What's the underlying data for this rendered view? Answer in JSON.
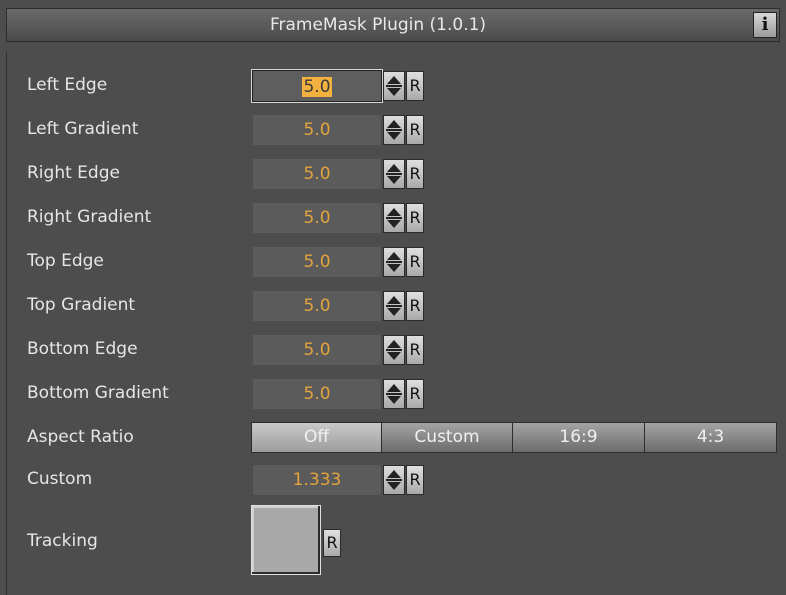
{
  "window": {
    "title": "FrameMask Plugin (1.0.1)",
    "info_label": "i"
  },
  "params": [
    {
      "label": "Left Edge",
      "value": "5.0",
      "active": true
    },
    {
      "label": "Left Gradient",
      "value": "5.0"
    },
    {
      "label": "Right Edge",
      "value": "5.0"
    },
    {
      "label": "Right Gradient",
      "value": "5.0"
    },
    {
      "label": "Top Edge",
      "value": "5.0"
    },
    {
      "label": "Top Gradient",
      "value": "5.0"
    },
    {
      "label": "Bottom Edge",
      "value": "5.0"
    },
    {
      "label": "Bottom Gradient",
      "value": "5.0"
    }
  ],
  "reset_label": "R",
  "aspect_ratio": {
    "label": "Aspect Ratio",
    "options": [
      "Off",
      "Custom",
      "16:9",
      "4:3"
    ],
    "selected": "Off"
  },
  "custom": {
    "label": "Custom",
    "value": "1.333"
  },
  "tracking": {
    "label": "Tracking"
  },
  "colors": {
    "value_text": "#e2a43c",
    "selection": "#f2b13e",
    "background": "#4d4d4d"
  }
}
